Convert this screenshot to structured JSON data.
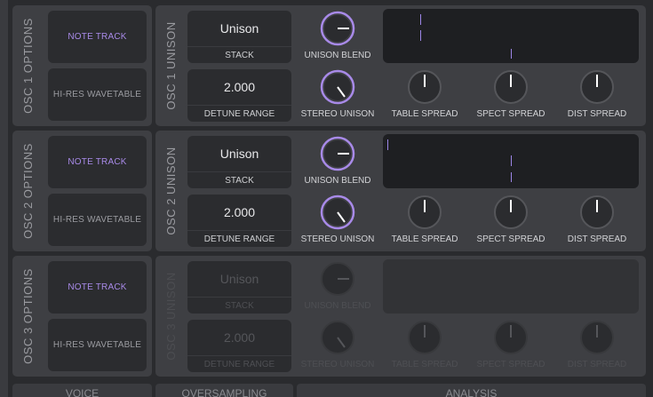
{
  "osc1": {
    "options_title": "OSC 1 OPTIONS",
    "unison_title": "OSC 1 UNISON",
    "note_track": "NOTE TRACK",
    "hires_wavetable": "HI-RES WAVETABLE",
    "stack_value": "Unison",
    "stack_label": "STACK",
    "detune_value": "2.000",
    "detune_label": "DETUNE RANGE",
    "unison_blend": "UNISON BLEND",
    "stereo_unison": "STEREO UNISON",
    "table_spread": "TABLE SPREAD",
    "spect_spread": "SPECT SPREAD",
    "dist_spread": "DIST SPREAD"
  },
  "osc2": {
    "options_title": "OSC 2 OPTIONS",
    "unison_title": "OSC 2 UNISON",
    "note_track": "NOTE TRACK",
    "hires_wavetable": "HI-RES WAVETABLE",
    "stack_value": "Unison",
    "stack_label": "STACK",
    "detune_value": "2.000",
    "detune_label": "DETUNE RANGE",
    "unison_blend": "UNISON BLEND",
    "stereo_unison": "STEREO UNISON",
    "table_spread": "TABLE SPREAD",
    "spect_spread": "SPECT SPREAD",
    "dist_spread": "DIST SPREAD"
  },
  "osc3": {
    "options_title": "OSC 3 OPTIONS",
    "unison_title": "OSC 3 UNISON",
    "note_track": "NOTE TRACK",
    "hires_wavetable": "HI-RES WAVETABLE",
    "stack_value": "Unison",
    "stack_label": "STACK",
    "detune_value": "2.000",
    "detune_label": "DETUNE RANGE",
    "unison_blend": "UNISON BLEND",
    "stereo_unison": "STEREO UNISON",
    "table_spread": "TABLE SPREAD",
    "spect_spread": "SPECT SPREAD",
    "dist_spread": "DIST SPREAD"
  },
  "bottom_tabs": [
    "VOICE",
    "OVERSAMPLING",
    "ANALYSIS"
  ],
  "colors": {
    "accent": "#a88ae8",
    "panel": "#3e3f43",
    "dark": "#2b2c2f",
    "scope": "#1e1f22"
  }
}
